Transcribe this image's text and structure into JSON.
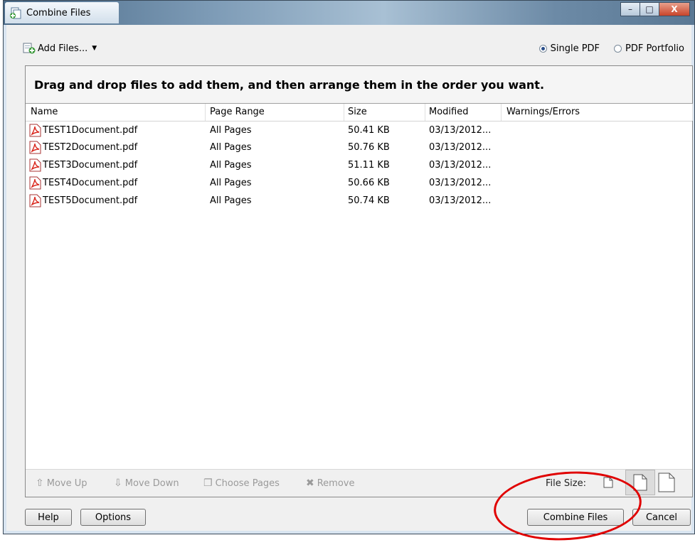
{
  "window": {
    "title": "Combine Files"
  },
  "toolbar": {
    "add_files_label": "Add Files...",
    "mode_single": "Single PDF",
    "mode_portfolio": "PDF Portfolio",
    "selected_mode": "Single PDF"
  },
  "instructions": "Drag and drop files to add them, and then arrange them in the order you want.",
  "table": {
    "columns": [
      "Name",
      "Page Range",
      "Size",
      "Modified",
      "Warnings/Errors"
    ],
    "rows": [
      {
        "name": "TEST1Document.pdf",
        "page_range": "All Pages",
        "size": "50.41 KB",
        "modified": "03/13/2012...",
        "warnings": ""
      },
      {
        "name": "TEST2Document.pdf",
        "page_range": "All Pages",
        "size": "50.76 KB",
        "modified": "03/13/2012...",
        "warnings": ""
      },
      {
        "name": "TEST3Document.pdf",
        "page_range": "All Pages",
        "size": "51.11 KB",
        "modified": "03/13/2012...",
        "warnings": ""
      },
      {
        "name": "TEST4Document.pdf",
        "page_range": "All Pages",
        "size": "50.66 KB",
        "modified": "03/13/2012...",
        "warnings": ""
      },
      {
        "name": "TEST5Document.pdf",
        "page_range": "All Pages",
        "size": "50.74 KB",
        "modified": "03/13/2012...",
        "warnings": ""
      }
    ]
  },
  "actions": {
    "move_up": "Move Up",
    "move_down": "Move Down",
    "choose_pages": "Choose Pages",
    "remove": "Remove",
    "file_size_label": "File Size:"
  },
  "buttons": {
    "help": "Help",
    "options": "Options",
    "combine": "Combine Files",
    "cancel": "Cancel"
  },
  "colors": {
    "annotation_circle": "#e00000",
    "pdf_icon_red": "#d9261c"
  }
}
